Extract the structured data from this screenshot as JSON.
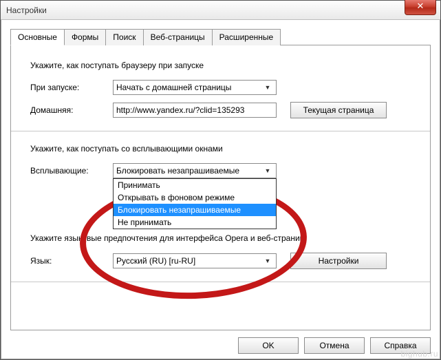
{
  "window": {
    "title": "Настройки"
  },
  "tabs": [
    "Основные",
    "Формы",
    "Поиск",
    "Веб-страницы",
    "Расширенные"
  ],
  "active_tab_index": 0,
  "startup": {
    "section_text": "Укажите, как поступать браузеру при запуске",
    "on_start_label": "При запуске:",
    "on_start_value": "Начать с домашней страницы",
    "home_label": "Домашняя:",
    "home_value": "http://www.yandex.ru/?clid=135293",
    "current_page_btn": "Текущая страница"
  },
  "popups": {
    "section_text": "Укажите, как поступать со всплывающими окнами",
    "label": "Всплывающие:",
    "selected": "Блокировать незапрашиваемые",
    "options": [
      "Принимать",
      "Открывать в фоновом режиме",
      "Блокировать незапрашиваемые",
      "Не принимать"
    ],
    "highlight_index": 2
  },
  "language": {
    "section_text": "Укажите языковые предпочтения для интерфейса Opera и веб-страниц",
    "label": "Язык:",
    "value": "Русский (RU) [ru-RU]",
    "settings_btn": "Настройки"
  },
  "footer": {
    "ok": "OK",
    "cancel": "Отмена",
    "help": "Справка"
  },
  "watermark": "bighub.ru"
}
